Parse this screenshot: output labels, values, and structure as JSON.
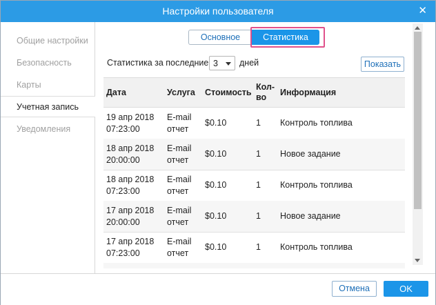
{
  "window": {
    "title": "Настройки пользователя",
    "close_glyph": "✕"
  },
  "sidebar": {
    "items": [
      {
        "label": "Общие настройки",
        "active": false
      },
      {
        "label": "Безопасность",
        "active": false
      },
      {
        "label": "Карты",
        "active": false
      },
      {
        "label": "Учетная запись",
        "active": true
      },
      {
        "label": "Уведомления",
        "active": false
      }
    ]
  },
  "tabs": {
    "basic": "Основное",
    "stats": "Статистика",
    "active": "stats"
  },
  "filter": {
    "label": "Статистика за последние",
    "days_value": "3",
    "days_suffix": "дней",
    "show_button": "Показать"
  },
  "table": {
    "headers": {
      "date": "Дата",
      "service": "Услуга",
      "cost": "Стоимость",
      "qty_line1": "Кол-",
      "qty_line2": "во",
      "info": "Информация"
    },
    "rows": [
      {
        "date1": "19 апр 2018",
        "date2": "07:23:00",
        "svc1": "E-mail",
        "svc2": "отчет",
        "cost": "$0.10",
        "qty": "1",
        "info": "Контроль топлива"
      },
      {
        "date1": "18 апр 2018",
        "date2": "20:00:00",
        "svc1": "E-mail",
        "svc2": "отчет",
        "cost": "$0.10",
        "qty": "1",
        "info": "Новое задание"
      },
      {
        "date1": "18 апр 2018",
        "date2": "07:23:00",
        "svc1": "E-mail",
        "svc2": "отчет",
        "cost": "$0.10",
        "qty": "1",
        "info": "Контроль топлива"
      },
      {
        "date1": "17 апр 2018",
        "date2": "20:00:00",
        "svc1": "E-mail",
        "svc2": "отчет",
        "cost": "$0.10",
        "qty": "1",
        "info": "Новое задание"
      },
      {
        "date1": "17 апр 2018",
        "date2": "07:23:00",
        "svc1": "E-mail",
        "svc2": "отчет",
        "cost": "$0.10",
        "qty": "1",
        "info": "Контроль топлива"
      }
    ]
  },
  "footer": {
    "cancel": "Отмена",
    "ok": "OK"
  },
  "colors": {
    "accent": "#1b95e8",
    "titlebar": "#2c9be5",
    "highlight": "#e0508a"
  }
}
